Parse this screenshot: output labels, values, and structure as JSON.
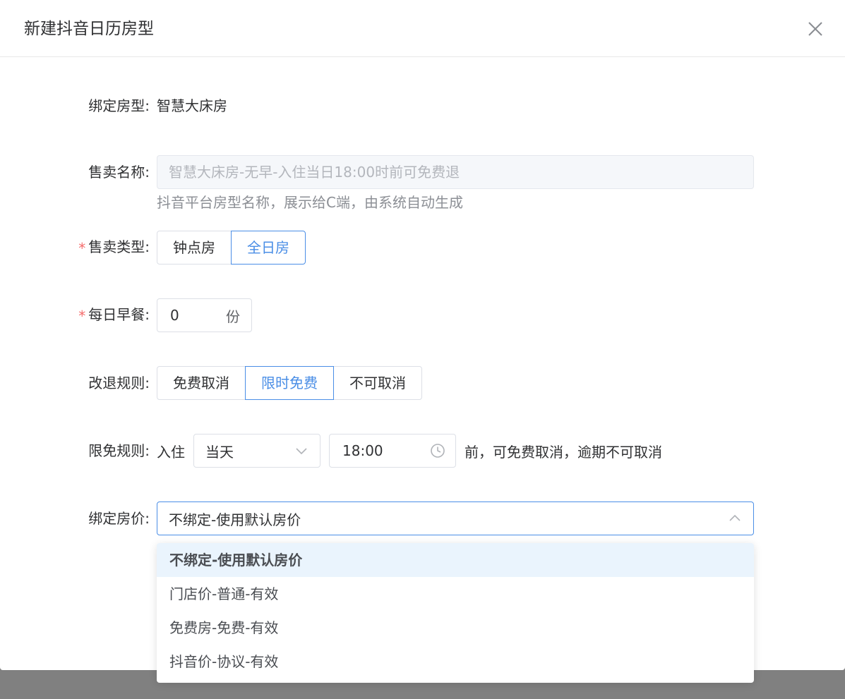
{
  "dialog": {
    "title": "新建抖音日历房型"
  },
  "form": {
    "bind_room_type": {
      "label": "绑定房型:",
      "value": "智慧大床房"
    },
    "sale_name": {
      "label": "售卖名称:",
      "placeholder": "智慧大床房-无早-入住当日18:00时前可免费退",
      "hint": "抖音平台房型名称，展示给C端，由系统自动生成"
    },
    "sale_type": {
      "required": "*",
      "label": "售卖类型:",
      "options": [
        "钟点房",
        "全日房"
      ],
      "selected": "全日房"
    },
    "breakfast": {
      "required": "*",
      "label": "每日早餐:",
      "value": "0",
      "unit": "份"
    },
    "cancel_rule": {
      "label": "改退规则:",
      "options": [
        "免费取消",
        "限时免费",
        "不可取消"
      ],
      "selected": "限时免费"
    },
    "free_rule": {
      "label": "限免规则:",
      "prefix": "入住",
      "day": "当天",
      "time": "18:00",
      "suffix": "前，可免费取消，逾期不可取消"
    },
    "bind_price": {
      "label": "绑定房价:",
      "value": "不绑定-使用默认房价",
      "options": [
        "不绑定-使用默认房价",
        "门店价-普通-有效",
        "免费房-免费-有效",
        "抖音价-协议-有效"
      ]
    }
  },
  "colors": {
    "accent": "#4a8ee6",
    "required": "#f56c6c",
    "selected_bg": "#eaf4fd"
  }
}
